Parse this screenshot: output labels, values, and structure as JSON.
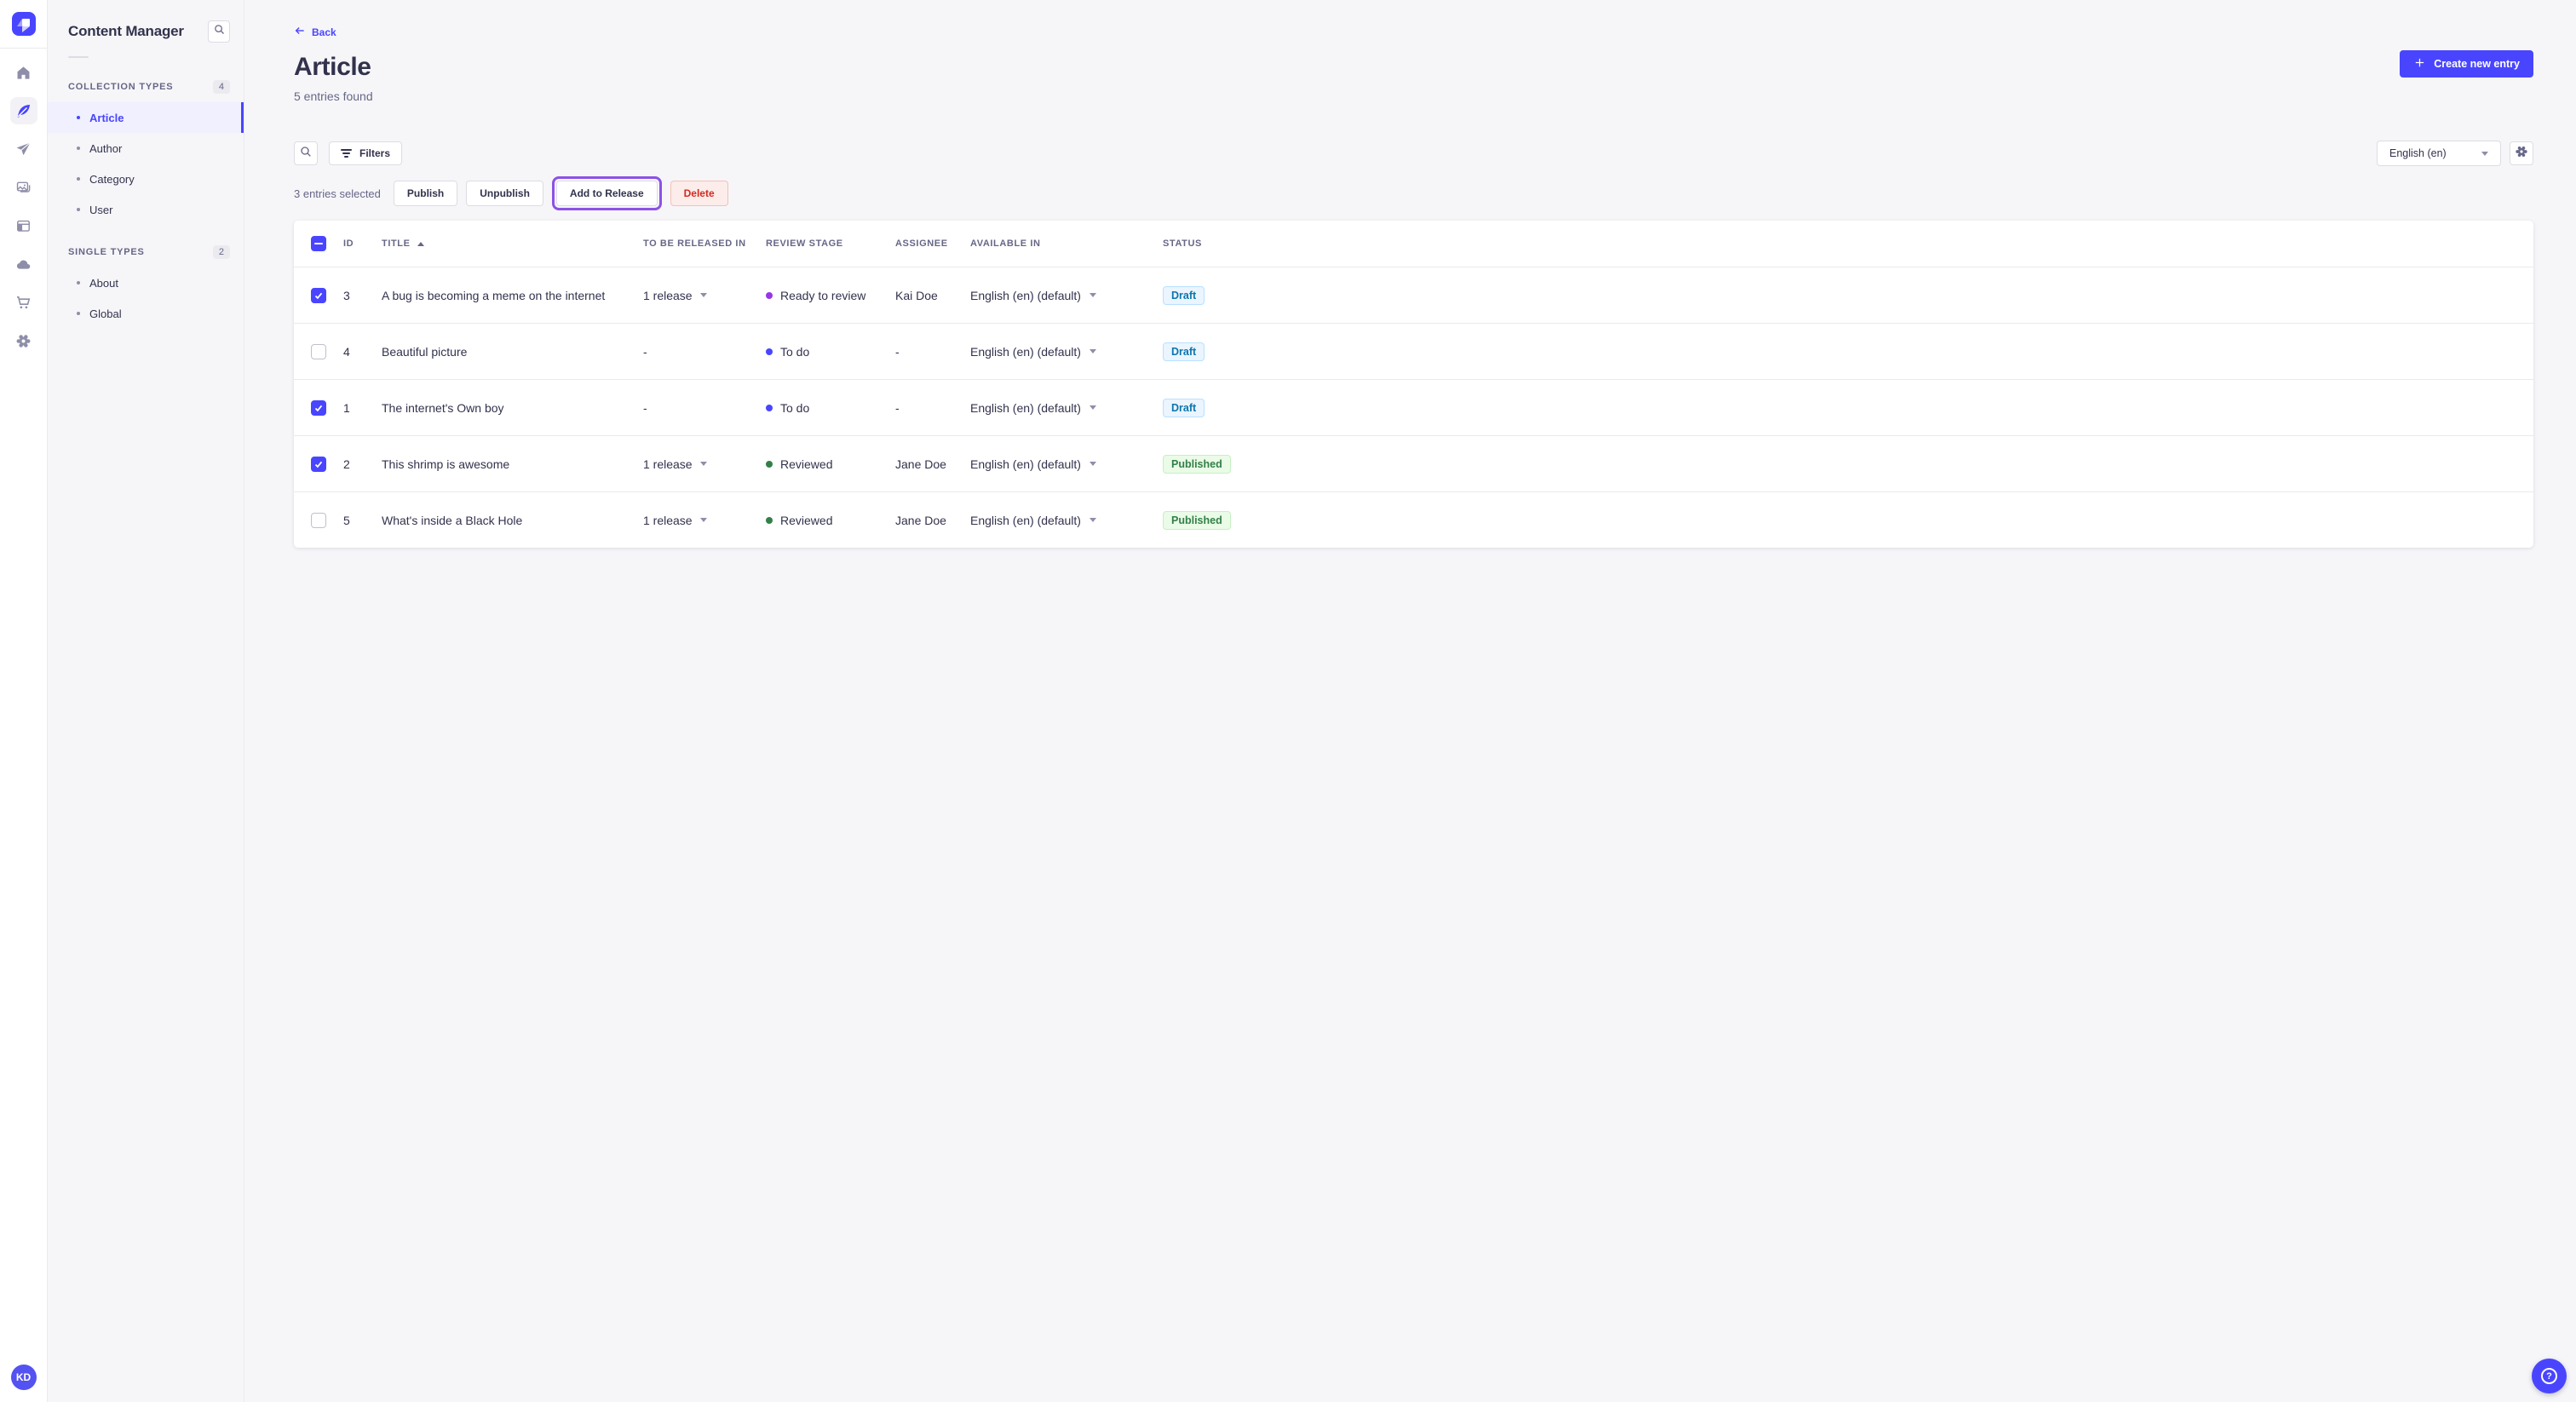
{
  "nav": {
    "logo_icon": "strapi-logo",
    "items": [
      {
        "icon": "home-icon"
      },
      {
        "icon": "content-manager-feather-icon",
        "active": true
      },
      {
        "icon": "releases-paper-plane-icon"
      },
      {
        "icon": "media-library-images-icon"
      },
      {
        "icon": "content-type-builder-layout-icon"
      },
      {
        "icon": "deploy-cloud-icon"
      },
      {
        "icon": "marketplace-cart-icon"
      },
      {
        "icon": "settings-gear-icon"
      }
    ],
    "avatar_initials": "KD"
  },
  "subnav": {
    "title": "Content Manager",
    "search_icon": "search-icon",
    "sections": [
      {
        "label": "COLLECTION TYPES",
        "count": "4",
        "items": [
          {
            "label": "Article",
            "active": true
          },
          {
            "label": "Author"
          },
          {
            "label": "Category"
          },
          {
            "label": "User"
          }
        ]
      },
      {
        "label": "SINGLE TYPES",
        "count": "2",
        "items": [
          {
            "label": "About"
          },
          {
            "label": "Global"
          }
        ]
      }
    ]
  },
  "header": {
    "back_label": "Back",
    "title": "Article",
    "subtitle": "5 entries found",
    "create_button_label": "Create new entry"
  },
  "toolbar": {
    "filters_label": "Filters",
    "locale_value": "English (en)"
  },
  "selection": {
    "count_text": "3 entries selected",
    "publish_label": "Publish",
    "unpublish_label": "Unpublish",
    "add_to_release_label": "Add to Release",
    "delete_label": "Delete"
  },
  "table": {
    "columns": [
      "ID",
      "TITLE",
      "TO BE RELEASED IN",
      "REVIEW STAGE",
      "ASSIGNEE",
      "AVAILABLE IN",
      "STATUS"
    ],
    "sorted_column": "TITLE",
    "sort_direction": "ascending",
    "rows": [
      {
        "checked": true,
        "id": "3",
        "title": "A bug is becoming a meme on the internet",
        "release": "1 release",
        "stage": "Ready to review",
        "stage_color": "#9736e8",
        "assignee": "Kai Doe",
        "locale": "English (en) (default)",
        "status": "Draft"
      },
      {
        "checked": false,
        "id": "4",
        "title": "Beautiful picture",
        "release": "-",
        "stage": "To do",
        "stage_color": "#4945ff",
        "assignee": "-",
        "locale": "English (en) (default)",
        "status": "Draft"
      },
      {
        "checked": true,
        "id": "1",
        "title": "The internet's Own boy",
        "release": "-",
        "stage": "To do",
        "stage_color": "#4945ff",
        "assignee": "-",
        "locale": "English (en) (default)",
        "status": "Draft"
      },
      {
        "checked": true,
        "id": "2",
        "title": "This shrimp is awesome",
        "release": "1 release",
        "stage": "Reviewed",
        "stage_color": "#328048",
        "assignee": "Jane Doe",
        "locale": "English (en) (default)",
        "status": "Published"
      },
      {
        "checked": false,
        "id": "5",
        "title": "What's inside a Black Hole",
        "release": "1 release",
        "stage": "Reviewed",
        "stage_color": "#328048",
        "assignee": "Jane Doe",
        "locale": "English (en) (default)",
        "status": "Published"
      }
    ]
  },
  "colors": {
    "accent": "#4945ff",
    "highlight_ring": "#8d52e5",
    "danger": "#d02b20",
    "draft_text": "#0c75af",
    "published_text": "#328048"
  }
}
